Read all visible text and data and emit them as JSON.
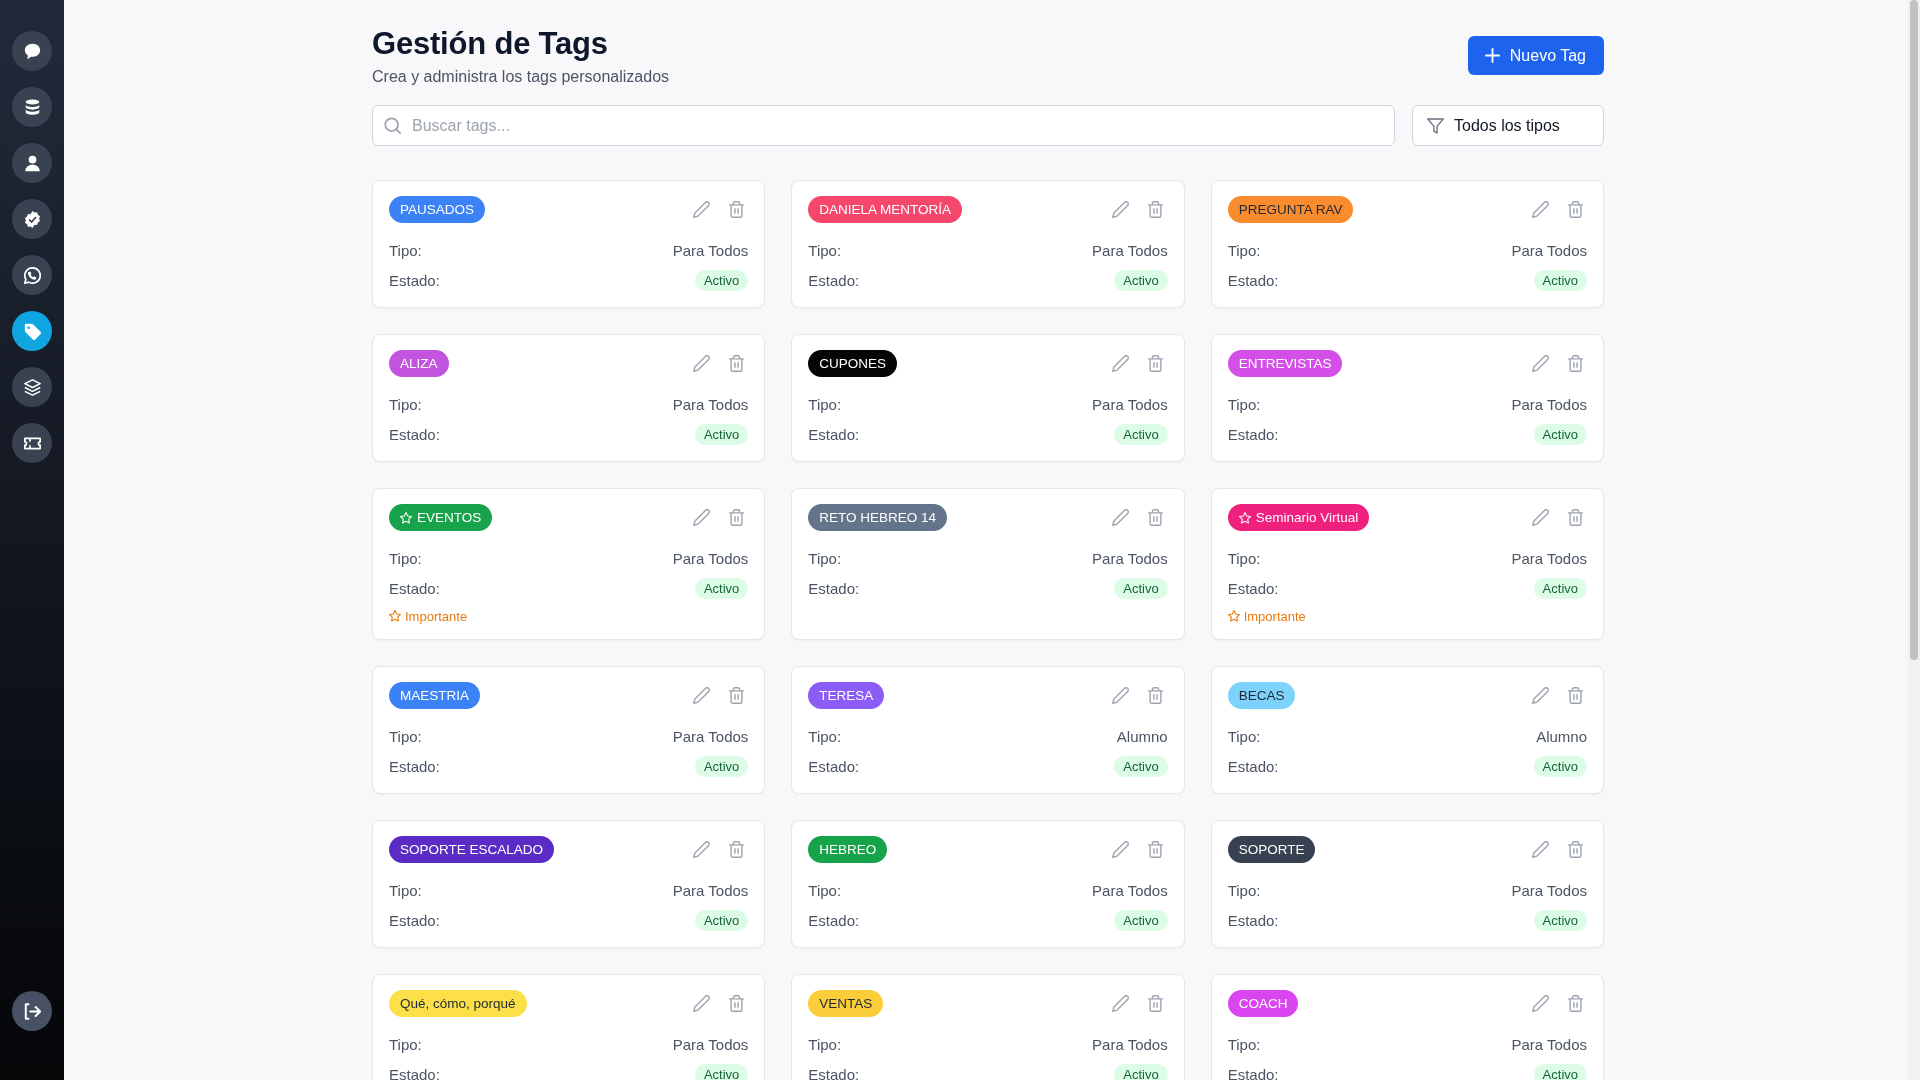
{
  "sidebar": {
    "items": [
      {
        "selected": false
      },
      {
        "selected": false
      },
      {
        "selected": false
      },
      {
        "selected": false
      },
      {
        "selected": false
      },
      {
        "selected": true
      },
      {
        "selected": false
      },
      {
        "selected": false
      }
    ]
  },
  "header": {
    "title": "Gestión de Tags",
    "subtitle": "Crea y administra los tags personalizados",
    "new_button": "Nuevo Tag"
  },
  "search": {
    "placeholder": "Buscar tags..."
  },
  "filter": {
    "value": "Todos los tipos"
  },
  "tags": [
    {
      "name": "PAUSADOS",
      "color": "#3b82f6",
      "starred": false,
      "fields": [
        {
          "kind": "text",
          "label": "Tipo:",
          "value": "Para Todos"
        },
        {
          "kind": "status",
          "label": "Estado:",
          "value": "Activo"
        }
      ]
    },
    {
      "name": "DANIELA MENTORÍA",
      "color": "#f4476b",
      "starred": false,
      "fields": [
        {
          "kind": "text",
          "label": "Tipo:",
          "value": "Para Todos"
        },
        {
          "kind": "status",
          "label": "Estado:",
          "value": "Activo"
        }
      ]
    },
    {
      "name": "PREGUNTA RAV",
      "color": "#fb8c2e",
      "starred": false,
      "fields": [
        {
          "kind": "text",
          "label": "Tipo:",
          "value": "Para Todos"
        },
        {
          "kind": "status",
          "label": "Estado:",
          "value": "Activo"
        }
      ]
    },
    {
      "name": "ALIZA",
      "color": "#c254df",
      "starred": false,
      "fields": [
        {
          "kind": "text",
          "label": "Tipo:",
          "value": "Para Todos"
        },
        {
          "kind": "status",
          "label": "Estado:",
          "value": "Activo"
        }
      ]
    },
    {
      "name": "CUPONES",
      "color": "#050505",
      "starred": false,
      "fields": [
        {
          "kind": "text",
          "label": "Tipo:",
          "value": "Para Todos"
        },
        {
          "kind": "status",
          "label": "Estado:",
          "value": "Activo"
        }
      ]
    },
    {
      "name": "ENTREVISTAS",
      "color": "#d44fe8",
      "starred": false,
      "fields": [
        {
          "kind": "text",
          "label": "Tipo:",
          "value": "Para Todos"
        },
        {
          "kind": "status",
          "label": "Estado:",
          "value": "Activo"
        }
      ]
    },
    {
      "name": "EVENTOS",
      "color": "#16a34a",
      "starred": true,
      "note": "Importante",
      "fields": [
        {
          "kind": "text",
          "label": "Tipo:",
          "value": "Para Todos"
        },
        {
          "kind": "status",
          "label": "Estado:",
          "value": "Activo"
        }
      ]
    },
    {
      "name": "RETO HEBREO 14",
      "color": "#64748b",
      "starred": false,
      "fields": [
        {
          "kind": "text",
          "label": "Tipo:",
          "value": "Para Todos"
        },
        {
          "kind": "status",
          "label": "Estado:",
          "value": "Activo"
        }
      ]
    },
    {
      "name": "Seminario Virtual",
      "color": "#f0207f",
      "starred": true,
      "note": "Importante",
      "fields": [
        {
          "kind": "text",
          "label": "Tipo:",
          "value": "Para Todos"
        },
        {
          "kind": "status",
          "label": "Estado:",
          "value": "Activo"
        }
      ]
    },
    {
      "name": "MAESTRIA",
      "color": "#3b82f6",
      "starred": false,
      "fields": [
        {
          "kind": "text",
          "label": "Tipo:",
          "value": "Para Todos"
        },
        {
          "kind": "status",
          "label": "Estado:",
          "value": "Activo"
        }
      ]
    },
    {
      "name": "TERESA",
      "color": "#8b5cf6",
      "starred": false,
      "fields": [
        {
          "kind": "text",
          "label": "Tipo:",
          "value": "Alumno"
        },
        {
          "kind": "status",
          "label": "Estado:",
          "value": "Activo"
        }
      ]
    },
    {
      "name": "BECAS",
      "color": "#7dd3fc",
      "starred": false,
      "fields": [
        {
          "kind": "text",
          "label": "Tipo:",
          "value": "Alumno"
        },
        {
          "kind": "status",
          "label": "Estado:",
          "value": "Activo"
        }
      ]
    },
    {
      "name": "SOPORTE ESCALADO",
      "color": "#5b2bc5",
      "starred": false,
      "fields": [
        {
          "kind": "text",
          "label": "Tipo:",
          "value": "Para Todos"
        },
        {
          "kind": "status",
          "label": "Estado:",
          "value": "Activo"
        }
      ]
    },
    {
      "name": "HEBREO",
      "color": "#16a34a",
      "starred": false,
      "fields": [
        {
          "kind": "text",
          "label": "Tipo:",
          "value": "Para Todos"
        },
        {
          "kind": "status",
          "label": "Estado:",
          "value": "Activo"
        }
      ]
    },
    {
      "name": "SOPORTE",
      "color": "#374151",
      "starred": false,
      "fields": [
        {
          "kind": "text",
          "label": "Tipo:",
          "value": "Para Todos"
        },
        {
          "kind": "status",
          "label": "Estado:",
          "value": "Activo"
        }
      ]
    },
    {
      "name": "Qué, cómo, porqué",
      "color": "#fde047",
      "starred": false,
      "fields": [
        {
          "kind": "text",
          "label": "Tipo:",
          "value": "Para Todos"
        },
        {
          "kind": "status",
          "label": "Estado:",
          "value": "Activo"
        }
      ]
    },
    {
      "name": "VENTAS",
      "color": "#fbcd3a",
      "starred": false,
      "fields": [
        {
          "kind": "text",
          "label": "Tipo:",
          "value": "Para Todos"
        },
        {
          "kind": "status",
          "label": "Estado:",
          "value": "Activo"
        }
      ]
    },
    {
      "name": "COACH",
      "color": "#d946ef",
      "starred": false,
      "fields": [
        {
          "kind": "text",
          "label": "Tipo:",
          "value": "Para Todos"
        },
        {
          "kind": "status",
          "label": "Estado:",
          "value": "Activo"
        }
      ]
    }
  ]
}
